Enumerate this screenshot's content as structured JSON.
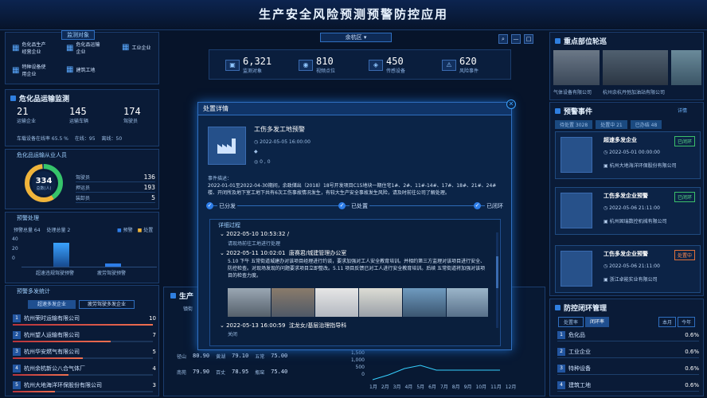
{
  "app_title": "生产安全风险预测预警防控应用",
  "region_select": "余杭区",
  "top_stats": [
    {
      "icon": "monitor-object-icon",
      "value": "6,321",
      "label": "监测对象"
    },
    {
      "icon": "video-point-icon",
      "value": "810",
      "label": "视频点位"
    },
    {
      "icon": "sensor-device-icon",
      "value": "450",
      "label": "传感设备"
    },
    {
      "icon": "risk-event-icon",
      "value": "620",
      "label": "风险事件"
    }
  ],
  "monitor_objects": {
    "title": "监测对象",
    "items": [
      "危化品生产经营企业",
      "危化品运输企业",
      "工业企业",
      "特种设备使用企业",
      "建筑工地"
    ]
  },
  "hazmat_transport": {
    "title": "危化品运输监测",
    "stats": [
      {
        "value": "21",
        "label": "运输企业"
      },
      {
        "value": "145",
        "label": "运输车辆"
      },
      {
        "value": "174",
        "label": "驾驶员"
      }
    ],
    "online_rate": "车载设备在线率 65.5 %",
    "online": "在线：95",
    "offline": "离线：50"
  },
  "staff": {
    "title": "危化品运输从业人员",
    "center_value": "334",
    "center_label": "总数(人)",
    "rows": [
      {
        "label": "驾驶员",
        "value": "136"
      },
      {
        "label": "押运员",
        "value": "193"
      },
      {
        "label": "装卸员",
        "value": "5"
      }
    ]
  },
  "warning": {
    "title": "预警处理",
    "total": "预警总量 64",
    "handled": "处理总量 2",
    "legend": [
      "预警",
      "处置"
    ],
    "xlabels": [
      "超速违规驾驶预警",
      "疲劳驾驶预警"
    ],
    "yticks": [
      "40",
      "20",
      "0"
    ]
  },
  "warning_stats": {
    "title": "预警多发统计",
    "tabs": [
      "超速多发企业",
      "疲劳驾驶多发企业"
    ],
    "rows": [
      {
        "rank": "1",
        "name": "杭州荣时运输有限公司",
        "value": "10",
        "pct": 1.0
      },
      {
        "rank": "2",
        "name": "杭州望人运输有限公司",
        "value": "7",
        "pct": 0.7
      },
      {
        "rank": "3",
        "name": "杭州华安燃气有限公司",
        "value": "5",
        "pct": 0.5
      },
      {
        "rank": "4",
        "name": "杭州余杭新公八合气体厂",
        "value": "4",
        "pct": 0.4
      },
      {
        "rank": "5",
        "name": "杭州大地海洋环保股份有限公司",
        "value": "3",
        "pct": 0.3
      }
    ]
  },
  "key_monitor": {
    "title": "重点部位轮巡",
    "cams": [
      "气体设备有限公司",
      "杭州余杭丹弛加油站有限公司",
      ""
    ]
  },
  "warn_events": {
    "title": "预警事件",
    "detail": "详情",
    "filters": [
      "待处置 3028",
      "处置中 21",
      "已办结 48"
    ],
    "cards": [
      {
        "title": "超速多发企业",
        "time": "2022-05-01 00:00:00",
        "org": "杭州大地海洋环保股份有限公司",
        "status": "已闭环"
      },
      {
        "title": "工伤多发企业预警",
        "time": "2022-05-06 21:11:00",
        "org": "杭州固瑞数控机械有限公司",
        "status": "已闭环"
      },
      {
        "title": "工伤多发企业预警",
        "time": "2022-05-06 21:11:00",
        "org": "浙江卓能实业有限公司",
        "status": "处置中"
      }
    ]
  },
  "closed_loop": {
    "title": "防控闭环管理",
    "tabs": [
      "处置率",
      "闭环率"
    ],
    "period": [
      "本月",
      "今年"
    ],
    "rows": [
      {
        "rank": "1",
        "name": "危化品",
        "value": "0.6%"
      },
      {
        "rank": "2",
        "name": "工业企业",
        "value": "0.6%"
      },
      {
        "rank": "3",
        "name": "特种设备",
        "value": "0.6%"
      },
      {
        "rank": "4",
        "name": "建筑工地",
        "value": "0.6%"
      }
    ]
  },
  "bottom_mid": {
    "title": "生产",
    "tab": "镇街",
    "pairs": [
      {
        "a": "径山",
        "av": "80.90",
        "b": "黄湖",
        "bv": "79.10",
        "c": "五常",
        "cv": "75.00"
      },
      {
        "a": "南苑",
        "av": "79.90",
        "b": "百丈",
        "bv": "78.95",
        "c": "瓶窑",
        "cv": "75.40"
      }
    ],
    "yticks": [
      "1,500",
      "1,000",
      "500",
      "0"
    ],
    "months": [
      "1月",
      "2月",
      "3月",
      "4月",
      "5月",
      "6月",
      "7月",
      "8月",
      "9月",
      "10月",
      "11月",
      "12月"
    ]
  },
  "modal": {
    "header": "处置详情",
    "event_title": "工伤多发工地预警",
    "event_time": "2022-05-05 16:00:00",
    "count": "0 , 0",
    "desc_label": "事件描述：",
    "desc": "2022-01-01至2022-04-30期间，余政储出（2018）18号开发项目C15地块一期住宅1#、2#、11#-14#、17#、18#、21#、24#楼、开闭所及地下室工地下共有6次工伤事故情况发生，有较大生产安全事故发生风险，请及时前往公司了解处理。",
    "steps": [
      "已分发",
      "已处置",
      "已闭环"
    ],
    "process_label": "详细过程",
    "log": [
      {
        "time": "2022-05-10 10:53:32",
        "who": "/",
        "text": "请现场前往工地进行处理"
      },
      {
        "time": "2022-05-11 10:02:01",
        "who": "唐赛君/城建管理办公室",
        "text": "5.10 下午 五常街道城建办对该项目经理进行约谈，要求加强对工人安全教育培训。并相约第三方监理对该项目进行安全、防控检查。对现场发现的问题要求项目立即整改。5.11 项目反馈已对工人进行安全教育培训。后续 五常街道将加强对该项目的检查力度。"
      },
      {
        "time": "2022-05-13 16:00:59",
        "who": "沈龙女/基层治理指导科",
        "text": "关闭"
      }
    ]
  }
}
